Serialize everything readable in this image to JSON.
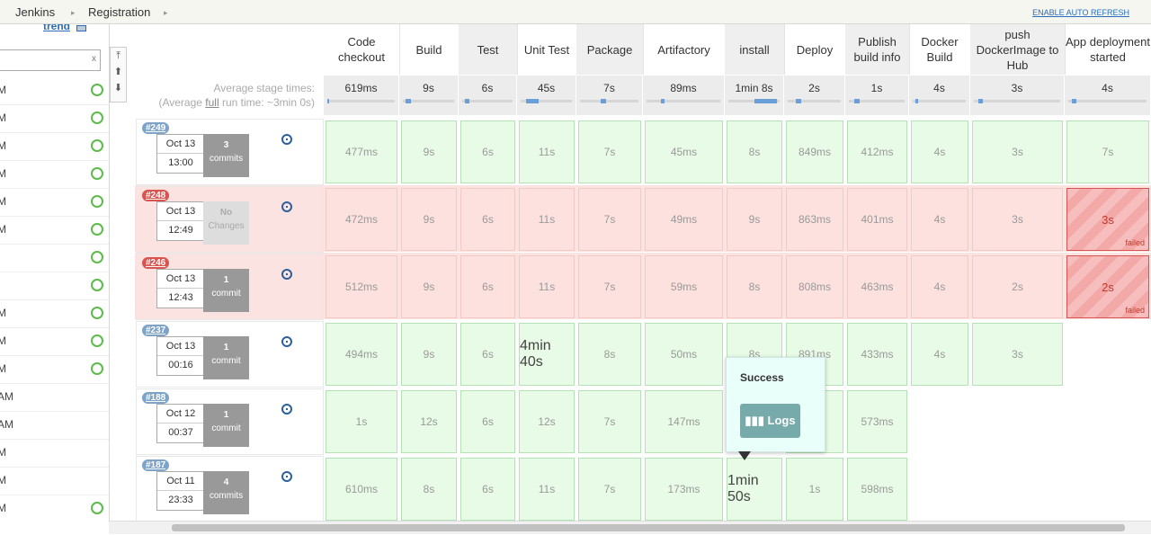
{
  "breadcrumb": {
    "items": [
      "Jenkins",
      "Registration"
    ],
    "auto_refresh": "ENABLE AUTO REFRESH"
  },
  "left_panel": {
    "trend_label": "trend",
    "filter_clear": "x",
    "rows": [
      {
        "time": "M",
        "ok": true
      },
      {
        "time": "M",
        "ok": true
      },
      {
        "time": "M",
        "ok": true
      },
      {
        "time": "M",
        "ok": true
      },
      {
        "time": "M",
        "ok": true
      },
      {
        "time": "M",
        "ok": true
      },
      {
        "time": "",
        "ok": true
      },
      {
        "time": "",
        "ok": true
      },
      {
        "time": "M",
        "ok": true
      },
      {
        "time": "M",
        "ok": true
      },
      {
        "time": "M",
        "ok": true
      },
      {
        "time": "AM",
        "ok": false
      },
      {
        "time": "AM",
        "ok": false
      },
      {
        "time": "M",
        "ok": false
      },
      {
        "time": "M",
        "ok": false
      },
      {
        "time": "M",
        "ok": true
      }
    ]
  },
  "avg": {
    "label": "Average stage times:",
    "full_pre": "(Average ",
    "full_word": "full",
    "full_post": " run time: ~3min 0s)"
  },
  "stages": [
    {
      "name": "Code checkout",
      "avg": "619ms"
    },
    {
      "name": "Build",
      "avg": "9s"
    },
    {
      "name": "Test",
      "avg": "6s"
    },
    {
      "name": "Unit Test",
      "avg": "45s"
    },
    {
      "name": "Package",
      "avg": "7s"
    },
    {
      "name": "Artifactory",
      "avg": "89ms"
    },
    {
      "name": "install",
      "avg": "1min 8s"
    },
    {
      "name": "Deploy",
      "avg": "2s"
    },
    {
      "name": "Publish build info",
      "avg": "1s"
    },
    {
      "name": "Docker Build",
      "avg": "4s"
    },
    {
      "name": "push DockerImage to Hub",
      "avg": "3s"
    },
    {
      "name": "App deployment started",
      "avg": "4s"
    }
  ],
  "builds": [
    {
      "id": "#249",
      "date": "Oct 13",
      "time": "13:00",
      "commits_n": "3",
      "commits_l": "commits",
      "status": "success",
      "cells": [
        "477ms",
        "9s",
        "6s",
        "11s",
        "7s",
        "45ms",
        "8s",
        "849ms",
        "412ms",
        "4s",
        "3s",
        "7s"
      ]
    },
    {
      "id": "#248",
      "date": "Oct 13",
      "time": "12:49",
      "commits_n": "No",
      "commits_l": "Changes",
      "status": "failed",
      "cells": [
        "472ms",
        "9s",
        "6s",
        "11s",
        "7s",
        "49ms",
        "9s",
        "863ms",
        "401ms",
        "4s",
        "3s",
        "3s"
      ]
    },
    {
      "id": "#246",
      "date": "Oct 13",
      "time": "12:43",
      "commits_n": "1",
      "commits_l": "commit",
      "status": "failed",
      "cells": [
        "512ms",
        "9s",
        "6s",
        "11s",
        "7s",
        "59ms",
        "8s",
        "808ms",
        "463ms",
        "4s",
        "2s",
        "2s"
      ]
    },
    {
      "id": "#237",
      "date": "Oct 13",
      "time": "00:16",
      "commits_n": "1",
      "commits_l": "commit",
      "status": "success",
      "cells": [
        "494ms",
        "9s",
        "6s",
        "4min 40s",
        "8s",
        "50ms",
        "8s",
        "891ms",
        "433ms",
        "4s",
        "3s",
        ""
      ]
    },
    {
      "id": "#188",
      "date": "Oct 12",
      "time": "00:37",
      "commits_n": "1",
      "commits_l": "commit",
      "status": "success",
      "cells": [
        "1s",
        "12s",
        "6s",
        "12s",
        "7s",
        "147ms",
        "",
        "1s",
        "573ms",
        "",
        "",
        ""
      ]
    },
    {
      "id": "#187",
      "date": "Oct 11",
      "time": "23:33",
      "commits_n": "4",
      "commits_l": "commits",
      "status": "success",
      "cells": [
        "610ms",
        "8s",
        "6s",
        "11s",
        "7s",
        "173ms",
        "1min 50s",
        "1s",
        "598ms",
        "",
        "",
        ""
      ]
    }
  ],
  "failed_label": "failed",
  "popup": {
    "title": "Success",
    "button": "Logs"
  },
  "colors": {
    "success": "#e8fbe6",
    "failed": "#f3a9a8",
    "failed_row": "#fbe3e1",
    "accent": "#2a6ebb"
  }
}
